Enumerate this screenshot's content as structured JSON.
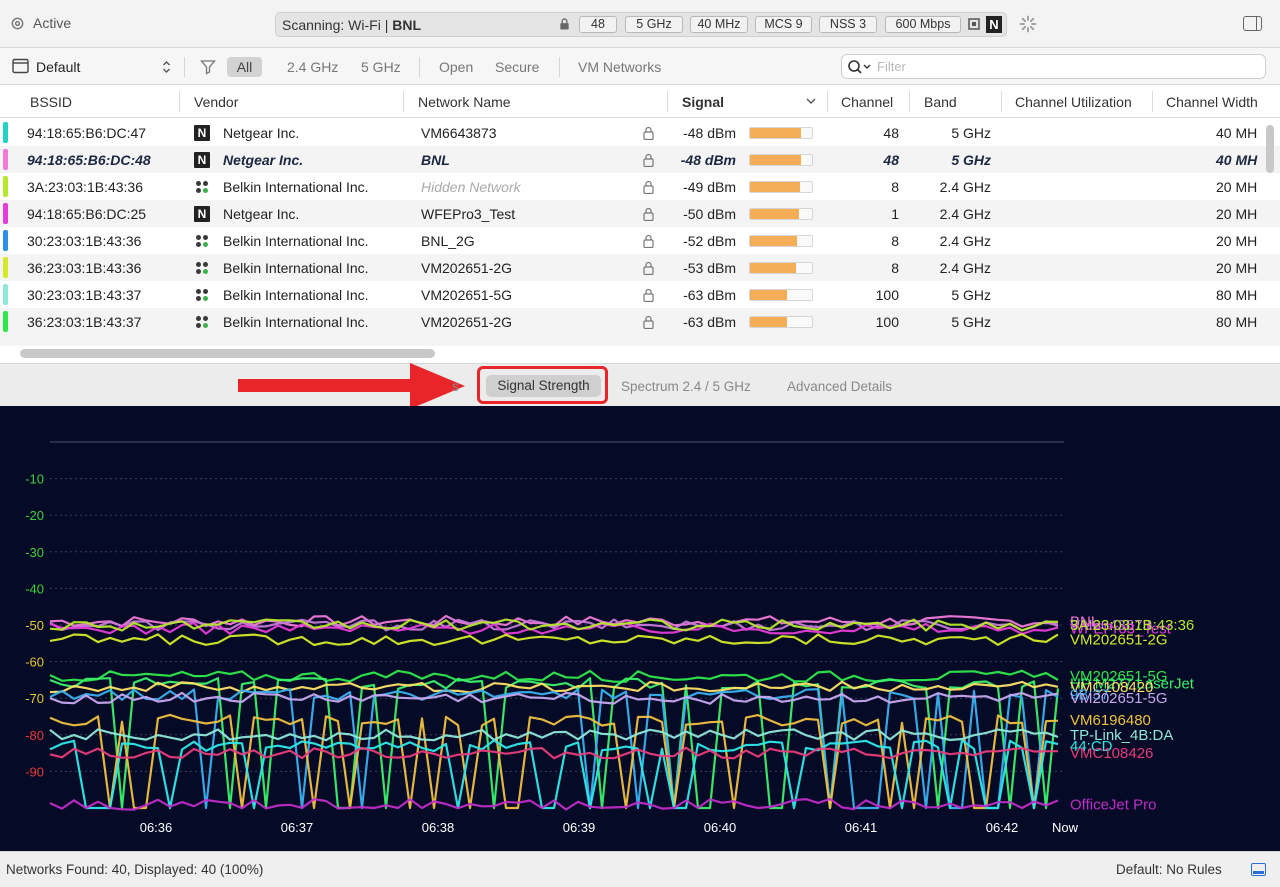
{
  "titlebar": {
    "status": "Active",
    "scan_prefix": "Scanning: Wi-Fi  |",
    "scan_network": "BNL",
    "pills": [
      "48",
      "5 GHz",
      "40 MHz",
      "MCS 9",
      "NSS 3",
      "600 Mbps"
    ],
    "vendor_badge": "N"
  },
  "filterbar": {
    "profile": "Default",
    "filters": [
      "All",
      "2.4 GHz",
      "5 GHz",
      "Open",
      "Secure",
      "VM Networks"
    ],
    "search_placeholder": "Filter"
  },
  "table": {
    "columns": [
      "BSSID",
      "Vendor",
      "Network Name",
      "Signal",
      "Channel",
      "Band",
      "Channel Utilization",
      "Channel Width"
    ],
    "rows": [
      {
        "bssid": "94:18:65:B6:DC:47",
        "vendor": "Netgear Inc.",
        "vendor_icon": "N",
        "name": "VM6643873",
        "signal": "-48 dBm",
        "signal_level": 0.82,
        "channel": "48",
        "band": "5 GHz",
        "width": "40 MH",
        "tag": "#1fd3c6"
      },
      {
        "bssid": "94:18:65:B6:DC:48",
        "vendor": "Netgear Inc.",
        "vendor_icon": "N",
        "name": "BNL",
        "signal": "-48 dBm",
        "signal_level": 0.82,
        "channel": "48",
        "band": "5 GHz",
        "width": "40 MH",
        "tag": "#f07ad8"
      },
      {
        "bssid": "3A:23:03:1B:43:36",
        "vendor": "Belkin International Inc.",
        "vendor_icon": "dots",
        "name": "Hidden Network",
        "signal": "-49 dBm",
        "signal_level": 0.8,
        "channel": "8",
        "band": "2.4 GHz",
        "width": "20 MH",
        "tag": "#b6e82c"
      },
      {
        "bssid": "94:18:65:B6:DC:25",
        "vendor": "Netgear Inc.",
        "vendor_icon": "N",
        "name": "WFEPro3_Test",
        "signal": "-50 dBm",
        "signal_level": 0.79,
        "channel": "1",
        "band": "2.4 GHz",
        "width": "20 MH",
        "tag": "#e83cd8"
      },
      {
        "bssid": "30:23:03:1B:43:36",
        "vendor": "Belkin International Inc.",
        "vendor_icon": "dots",
        "name": "BNL_2G",
        "signal": "-52 dBm",
        "signal_level": 0.76,
        "channel": "8",
        "band": "2.4 GHz",
        "width": "20 MH",
        "tag": "#2a8fe8"
      },
      {
        "bssid": "36:23:03:1B:43:36",
        "vendor": "Belkin International Inc.",
        "vendor_icon": "dots",
        "name": "VM202651-2G",
        "signal": "-53 dBm",
        "signal_level": 0.74,
        "channel": "8",
        "band": "2.4 GHz",
        "width": "20 MH",
        "tag": "#d4ea28"
      },
      {
        "bssid": "30:23:03:1B:43:37",
        "vendor": "Belkin International Inc.",
        "vendor_icon": "dots",
        "name": "VM202651-5G",
        "signal": "-63 dBm",
        "signal_level": 0.6,
        "channel": "100",
        "band": "5 GHz",
        "width": "80 MH",
        "tag": "#8fe8d8"
      },
      {
        "bssid": "36:23:03:1B:43:37",
        "vendor": "Belkin International Inc.",
        "vendor_icon": "dots",
        "name": "VM202651-2G",
        "signal": "-63 dBm",
        "signal_level": 0.6,
        "channel": "100",
        "band": "5 GHz",
        "width": "80 MH",
        "tag": "#2ee84a"
      }
    ]
  },
  "tabs": {
    "partial": "s",
    "active": "Signal Strength",
    "others": [
      "Spectrum 2.4 / 5 GHz",
      "Advanced Details"
    ]
  },
  "chart_data": {
    "type": "line",
    "y_ticks": [
      -10,
      -20,
      -30,
      -40,
      -50,
      -60,
      -70,
      -80,
      -90
    ],
    "x_ticks": [
      "06:36",
      "06:37",
      "06:38",
      "06:39",
      "06:40",
      "06:41",
      "06:42",
      "Now"
    ],
    "ylim": [
      0,
      -100
    ],
    "background": "#050a26",
    "series": [
      {
        "name": "BNL",
        "color": "#f07ad8",
        "level": -49
      },
      {
        "name": "VM6643873",
        "color": "#c77ad8",
        "level": -50
      },
      {
        "name": "WFEPro3_Test",
        "color": "#e83cd8",
        "level": -51
      },
      {
        "name": "3A:23:03:1B:43:36",
        "color": "#b6e82c",
        "level": -50
      },
      {
        "name": "VM202651-2G",
        "color": "#d4ea28",
        "level": -54
      },
      {
        "name": "VM202651-5G",
        "color": "#2ee84a",
        "level": -64
      },
      {
        "name": "HP M277 LaserJet",
        "color": "#3cf06a",
        "level": -66
      },
      {
        "name": "VMC108420",
        "color": "#ffe066",
        "level": -67
      },
      {
        "name": "9B:37",
        "color": "#3ab0f0",
        "level": -69
      },
      {
        "name": "VM202651-5G",
        "color": "#c8a8f0",
        "level": -70
      },
      {
        "name": "VM6196480",
        "color": "#f0c040",
        "level": -76
      },
      {
        "name": "TP-Link_4B:DA",
        "color": "#8fe8d8",
        "level": -80
      },
      {
        "name": "44:CD",
        "color": "#2ee8e8",
        "level": -83
      },
      {
        "name": "VMC108426",
        "color": "#e83c7a",
        "level": -85
      },
      {
        "name": "OfficeJet Pro",
        "color": "#c02cc8",
        "level": -99
      }
    ]
  },
  "status": {
    "left": "Networks Found: 40, Displayed: 40 (100%)",
    "right": "Default: No Rules"
  }
}
